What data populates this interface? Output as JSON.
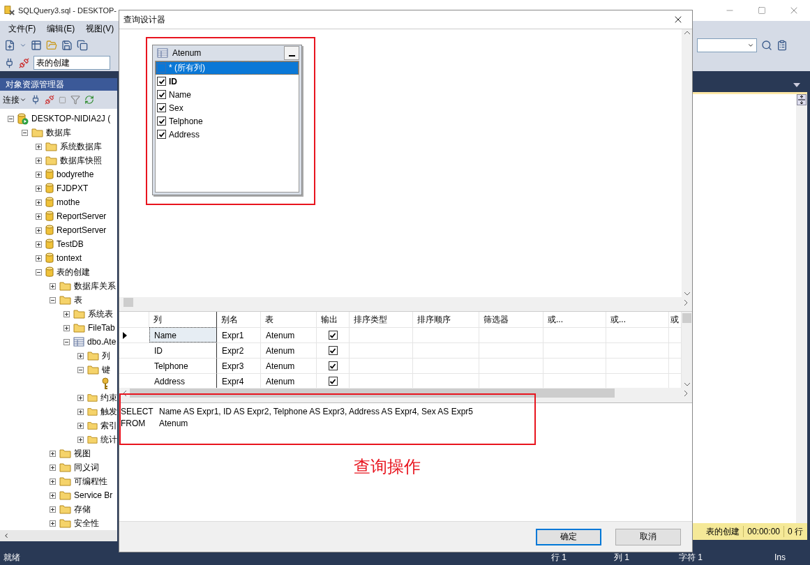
{
  "window": {
    "title": "SQLQuery3.sql - DESKTOP-"
  },
  "menu": [
    "文件(F)",
    "编辑(E)",
    "视图(V)"
  ],
  "toolbar": {
    "database_selector": "表的创建"
  },
  "object_explorer": {
    "title": "对象资源管理器",
    "connect_label": "连接",
    "tree": [
      {
        "label": "DESKTOP-NIDIA2J (",
        "kind": "server",
        "expanded": true,
        "children": [
          {
            "label": "数据库",
            "kind": "folder",
            "expanded": true,
            "children": [
              {
                "label": "系统数据库",
                "kind": "folder",
                "expanded": false
              },
              {
                "label": "数据库快照",
                "kind": "folder",
                "expanded": false
              },
              {
                "label": "bodyrethe",
                "kind": "database",
                "expanded": false
              },
              {
                "label": "FJDPXT",
                "kind": "database",
                "expanded": false
              },
              {
                "label": "mothe",
                "kind": "database",
                "expanded": false
              },
              {
                "label": "ReportServer",
                "kind": "database",
                "expanded": false
              },
              {
                "label": "ReportServer",
                "kind": "database",
                "expanded": false
              },
              {
                "label": "TestDB",
                "kind": "database",
                "expanded": false
              },
              {
                "label": "tontext",
                "kind": "database",
                "expanded": false
              },
              {
                "label": "表的创建",
                "kind": "database",
                "expanded": true,
                "children": [
                  {
                    "label": "数据库关系",
                    "kind": "folder",
                    "expanded": false
                  },
                  {
                    "label": "表",
                    "kind": "folder",
                    "expanded": true,
                    "children": [
                      {
                        "label": "系统表",
                        "kind": "folder",
                        "expanded": false
                      },
                      {
                        "label": "FileTab",
                        "kind": "folder",
                        "expanded": false
                      },
                      {
                        "label": "dbo.Ate",
                        "kind": "table",
                        "expanded": true,
                        "children": [
                          {
                            "label": "列",
                            "kind": "folder",
                            "expanded": false
                          },
                          {
                            "label": "键",
                            "kind": "folder",
                            "expanded": true,
                            "children": [
                              {
                                "kind": "key"
                              }
                            ]
                          },
                          {
                            "label": "约束",
                            "kind": "folder",
                            "expanded": false
                          },
                          {
                            "label": "触发",
                            "kind": "folder",
                            "expanded": false
                          },
                          {
                            "label": "索引",
                            "kind": "folder",
                            "expanded": false
                          },
                          {
                            "label": "统计",
                            "kind": "folder",
                            "expanded": false
                          }
                        ]
                      }
                    ]
                  },
                  {
                    "label": "视图",
                    "kind": "folder",
                    "expanded": false
                  },
                  {
                    "label": "同义词",
                    "kind": "folder",
                    "expanded": false
                  },
                  {
                    "label": "可编程性",
                    "kind": "folder",
                    "expanded": false
                  },
                  {
                    "label": "Service Br",
                    "kind": "folder",
                    "expanded": false
                  },
                  {
                    "label": "存储",
                    "kind": "folder",
                    "expanded": false
                  },
                  {
                    "label": "安全性",
                    "kind": "folder",
                    "expanded": false
                  }
                ]
              }
            ]
          }
        ]
      }
    ]
  },
  "editor": {
    "results_status": {
      "database": "表的创建",
      "elapsed": "00:00:00",
      "rows": "0 行"
    }
  },
  "status_bar": {
    "state": "就绪",
    "line": "行 1",
    "column": "列 1",
    "char": "字符 1",
    "mode": "Ins"
  },
  "dialog": {
    "title": "查询设计器",
    "table": {
      "name": "Atenum",
      "columns": [
        {
          "label": "* (所有列)",
          "checked": false,
          "selected": true,
          "primary_key": false
        },
        {
          "label": "ID",
          "checked": true,
          "selected": false,
          "primary_key": true
        },
        {
          "label": "Name",
          "checked": true,
          "selected": false,
          "primary_key": false
        },
        {
          "label": "Sex",
          "checked": true,
          "selected": false,
          "primary_key": false
        },
        {
          "label": "Telphone",
          "checked": true,
          "selected": false,
          "primary_key": false
        },
        {
          "label": "Address",
          "checked": true,
          "selected": false,
          "primary_key": false
        }
      ]
    },
    "grid": {
      "columns": [
        "列",
        "别名",
        "表",
        "输出",
        "排序类型",
        "排序顺序",
        "筛选器",
        "或...",
        "或...",
        "或"
      ],
      "rows": [
        {
          "column": "Name",
          "alias": "Expr1",
          "table": "Atenum",
          "output": true,
          "selected": true
        },
        {
          "column": "ID",
          "alias": "Expr2",
          "table": "Atenum",
          "output": true,
          "selected": false
        },
        {
          "column": "Telphone",
          "alias": "Expr3",
          "table": "Atenum",
          "output": true,
          "selected": false
        },
        {
          "column": "Address",
          "alias": "Expr4",
          "table": "Atenum",
          "output": true,
          "selected": false
        }
      ]
    },
    "sql": [
      {
        "keyword": "SELECT",
        "text": "Name AS Expr1, ID AS Expr2, Telphone AS Expr3, Address AS Expr4, Sex AS Expr5"
      },
      {
        "keyword": "FROM",
        "text": "Atenum"
      }
    ],
    "annotation": "查询操作",
    "buttons": [
      {
        "label": "确定",
        "default": true
      },
      {
        "label": "取消",
        "default": false
      }
    ]
  }
}
